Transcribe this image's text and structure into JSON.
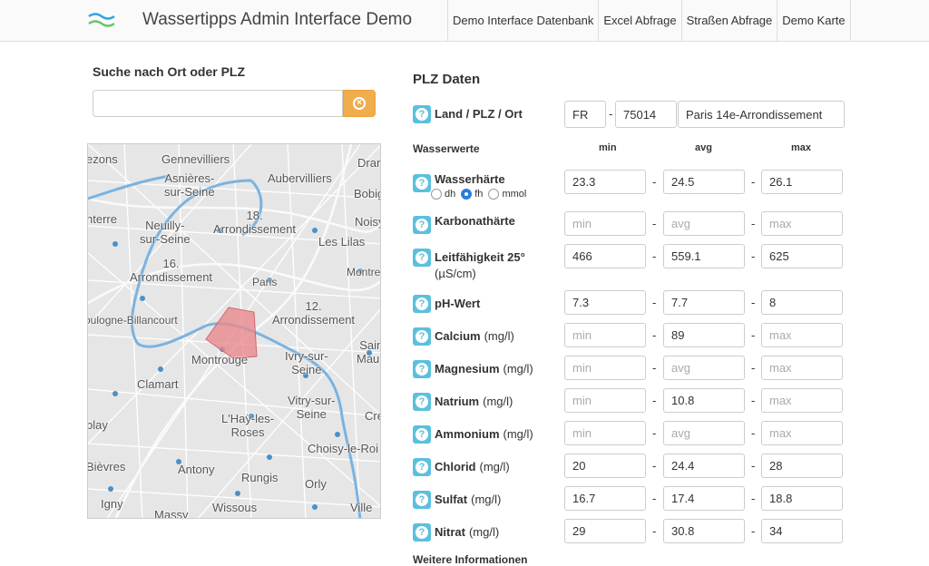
{
  "header": {
    "brand": "Wassertipps Admin Interface Demo",
    "nav": [
      "Demo Interface Datenbank",
      "Excel Abfrage",
      "Straßen Abfrage",
      "Demo Karte"
    ]
  },
  "search": {
    "title": "Suche nach Ort oder PLZ",
    "value": "",
    "clear_icon": "times-circle-icon"
  },
  "map": {
    "labels": [
      "ezons",
      "Gennevilliers",
      "Drar",
      "Asnières-\nsur-Seine",
      "Aubervilliers",
      "Bobig",
      "nterre",
      "18.\nArrondissement",
      "Noisy",
      "Neuilly-\nsur-Seine",
      "Les Lilas",
      "16.\nArrondissement",
      "Montre",
      "Paris",
      "oulogne-Billancourt",
      "12.\nArrondissement",
      "Sain\nMauri",
      "Montrouge",
      "Ivry-sur-\nSeine",
      "Clamart",
      "Vitry-sur-\nSeine",
      "L'Haÿ-les-\nRoses",
      "Cré",
      "Choisy-le-Roi",
      "blay",
      "Antony",
      "Rungis",
      "Bièvres",
      "Orly",
      "Igny",
      "Wissous",
      "Massy",
      "Ville"
    ]
  },
  "plz": {
    "title": "PLZ Daten",
    "location_label": "Land / PLZ / Ort",
    "country": "FR",
    "postcode": "75014",
    "city": "Paris 14e-Arrondissement"
  },
  "water": {
    "title": "Wasserwerte",
    "col_min": "min",
    "col_avg": "avg",
    "col_max": "max",
    "hardness_units": [
      "dh",
      "fh",
      "mmol"
    ],
    "hardness_selected": "fh",
    "rows": [
      {
        "label": "Wasserhärte",
        "unit": "",
        "min": "23.3",
        "avg": "24.5",
        "max": "26.1"
      },
      {
        "label": "Karbonathärte",
        "unit": "",
        "min": "",
        "avg": "",
        "max": ""
      },
      {
        "label": "Leitfähigkeit 25°",
        "unit": "(µS/cm)",
        "min": "466",
        "avg": "559.1",
        "max": "625"
      },
      {
        "label": "pH-Wert",
        "unit": "",
        "min": "7.3",
        "avg": "7.7",
        "max": "8"
      },
      {
        "label": "Calcium",
        "unit": "(mg/l)",
        "min": "",
        "avg": "89",
        "max": ""
      },
      {
        "label": "Magnesium",
        "unit": "(mg/l)",
        "min": "",
        "avg": "",
        "max": ""
      },
      {
        "label": "Natrium",
        "unit": "(mg/l)",
        "min": "",
        "avg": "10.8",
        "max": ""
      },
      {
        "label": "Ammonium",
        "unit": "(mg/l)",
        "min": "",
        "avg": "",
        "max": ""
      },
      {
        "label": "Chlorid",
        "unit": "(mg/l)",
        "min": "20",
        "avg": "24.4",
        "max": "28"
      },
      {
        "label": "Sulfat",
        "unit": "(mg/l)",
        "min": "16.7",
        "avg": "17.4",
        "max": "18.8"
      },
      {
        "label": "Nitrat",
        "unit": "(mg/l)",
        "min": "29",
        "avg": "30.8",
        "max": "34"
      }
    ],
    "placeholders": {
      "min": "min",
      "avg": "avg",
      "max": "max"
    }
  },
  "more_info": "Weitere Informationen",
  "colors": {
    "accent": "#5bc0de",
    "warning": "#f0ad4e",
    "highlight": "#e88a8f",
    "river": "#7ab3e0"
  }
}
